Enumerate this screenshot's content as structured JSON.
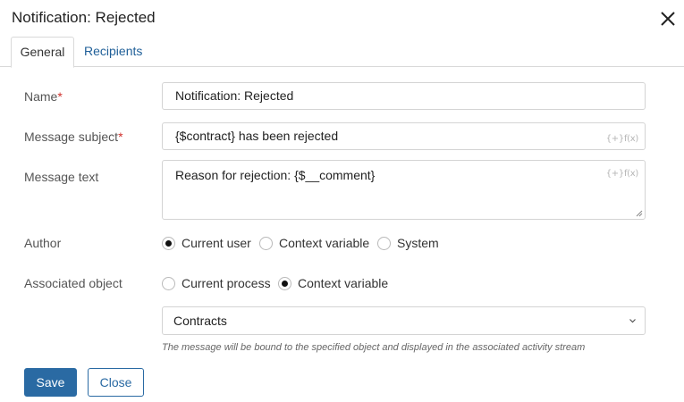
{
  "dialog": {
    "title": "Notification: Rejected",
    "close_icon": "close-icon"
  },
  "tabs": [
    {
      "label": "General",
      "active": true
    },
    {
      "label": "Recipients",
      "active": false
    }
  ],
  "form": {
    "name": {
      "label": "Name",
      "required_mark": "*",
      "value": "Notification: Rejected"
    },
    "subject": {
      "label": "Message subject",
      "required_mark": "*",
      "value": "{$contract} has been rejected",
      "insert_icon": "{+}f(x)"
    },
    "text": {
      "label": "Message text",
      "value": "Reason for rejection: {$__comment}",
      "insert_icon": "{+}f(x)"
    },
    "author": {
      "label": "Author",
      "options": [
        {
          "label": "Current user",
          "selected": true
        },
        {
          "label": "Context variable",
          "selected": false
        },
        {
          "label": "System",
          "selected": false
        }
      ]
    },
    "associated_object": {
      "label": "Associated object",
      "options": [
        {
          "label": "Current process",
          "selected": false
        },
        {
          "label": "Context variable",
          "selected": true
        }
      ],
      "select_value": "Contracts",
      "hint": "The message will be bound to the specified object and displayed in the associated activity stream"
    }
  },
  "buttons": {
    "save": "Save",
    "close": "Close"
  },
  "colors": {
    "accent": "#2a6aa3",
    "link": "#1f5f98",
    "required": "#d0312d"
  }
}
